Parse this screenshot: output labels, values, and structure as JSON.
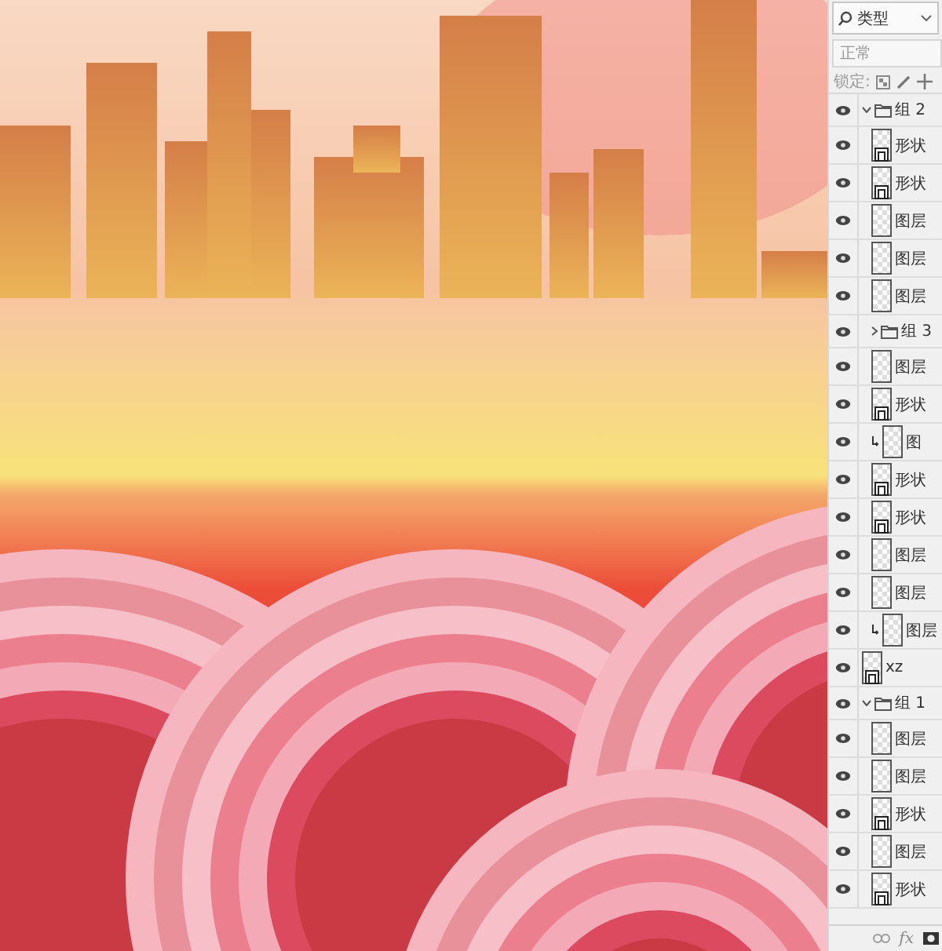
{
  "layers_panel": {
    "filter": {
      "label": "类型"
    },
    "blend_mode": {
      "placeholder": "正常"
    },
    "lock": {
      "label": "锁定:"
    },
    "layers": [
      {
        "kind": "group",
        "name": "组 2",
        "visible": true,
        "expanded": true,
        "children": [
          {
            "kind": "shape",
            "name": "形状",
            "visible": true,
            "clipped": false
          },
          {
            "kind": "shape",
            "name": "形状",
            "visible": true,
            "clipped": false
          },
          {
            "kind": "pixel",
            "name": "图层",
            "visible": true,
            "clipped": false
          },
          {
            "kind": "pixel",
            "name": "图层",
            "visible": true,
            "clipped": false
          },
          {
            "kind": "pixel",
            "name": "图层",
            "visible": true,
            "clipped": false
          },
          {
            "kind": "group",
            "name": "组 3",
            "visible": true,
            "expanded": false
          },
          {
            "kind": "pixel",
            "name": "图层",
            "visible": true,
            "clipped": false
          },
          {
            "kind": "shape",
            "name": "形状",
            "visible": true,
            "clipped": false
          },
          {
            "kind": "pixel",
            "name": "图",
            "visible": true,
            "clipped": true
          },
          {
            "kind": "shape",
            "name": "形状",
            "visible": true,
            "clipped": false
          },
          {
            "kind": "shape",
            "name": "形状",
            "visible": true,
            "clipped": false
          },
          {
            "kind": "pixel",
            "name": "图层",
            "visible": true,
            "clipped": false
          },
          {
            "kind": "pixel",
            "name": "图层",
            "visible": true,
            "clipped": false
          },
          {
            "kind": "pixel",
            "name": "图层",
            "visible": true,
            "clipped": true
          }
        ]
      },
      {
        "kind": "shape",
        "name": "xz",
        "visible": true,
        "clipped": false
      },
      {
        "kind": "group",
        "name": "组 1",
        "visible": true,
        "expanded": true,
        "children": [
          {
            "kind": "pixel",
            "name": "图层",
            "visible": true,
            "clipped": false
          },
          {
            "kind": "pixel",
            "name": "图层",
            "visible": true,
            "clipped": false
          },
          {
            "kind": "shape",
            "name": "形状",
            "visible": true,
            "clipped": false
          },
          {
            "kind": "pixel",
            "name": "图层",
            "visible": true,
            "clipped": false
          },
          {
            "kind": "shape",
            "name": "形状",
            "visible": true,
            "clipped": false
          }
        ]
      }
    ],
    "footer": {
      "fx": "fx"
    }
  }
}
